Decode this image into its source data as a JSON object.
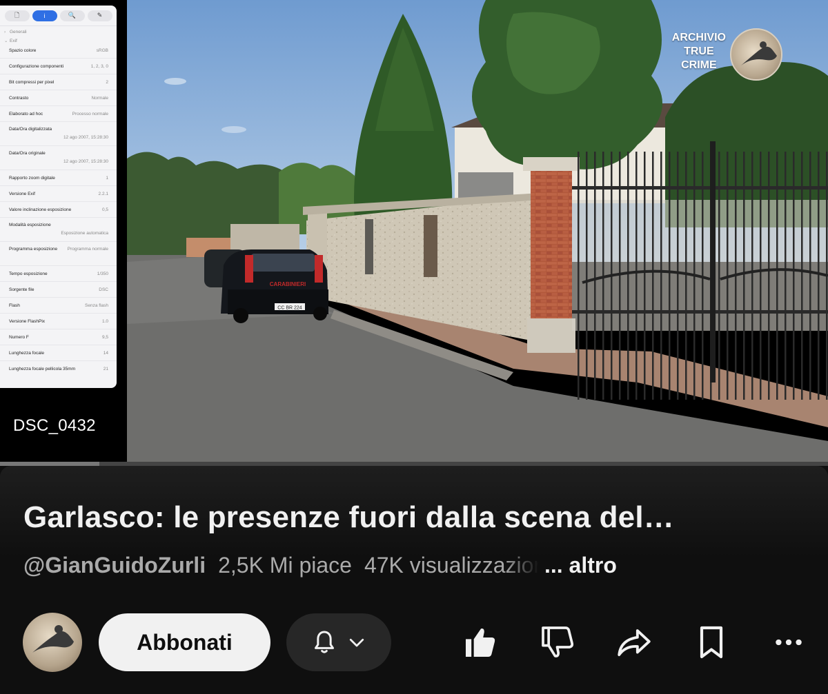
{
  "exif": {
    "toolbar_tabs": [
      {
        "icon": "document-icon",
        "glyph": "🗋"
      },
      {
        "icon": "info-icon",
        "glyph": "i"
      },
      {
        "icon": "search-icon",
        "glyph": "🔍"
      },
      {
        "icon": "edit-icon",
        "glyph": "✎"
      }
    ],
    "groups": [
      "Generali",
      "Exif"
    ],
    "rows": [
      {
        "key": "Spazio colore",
        "value": "sRGB"
      },
      {
        "key": "Configurazione componenti",
        "value": "1, 2, 3, 0"
      },
      {
        "key": "Bit compressi per pixel",
        "value": "2"
      },
      {
        "key": "Contrasto",
        "value": "Normale"
      },
      {
        "key": "Elaborato ad hoc",
        "value": "Processo normale"
      },
      {
        "key": "Data/Ora digitalizzata",
        "value": "12 ago 2007, 15:28:30"
      },
      {
        "key": "Data/Ora originale",
        "value": "12 ago 2007, 15:28:30"
      },
      {
        "key": "Rapporto zoom digitale",
        "value": "1"
      },
      {
        "key": "Versione Exif",
        "value": "2.2.1"
      },
      {
        "key": "Valore inclinazione esposizione",
        "value": "0,5"
      },
      {
        "key": "Modalità esposizione",
        "value": "Esposizione automatica"
      },
      {
        "key": "Programma esposizione",
        "value": "Programma normale"
      },
      {
        "key": "Tempo esposizione",
        "value": "1/350"
      },
      {
        "key": "Sorgente file",
        "value": "DSC"
      },
      {
        "key": "Flash",
        "value": "Senza flash"
      },
      {
        "key": "Versione FlashPix",
        "value": "1.0"
      },
      {
        "key": "Numero F",
        "value": "9,5"
      },
      {
        "key": "Lunghezza focale",
        "value": "14"
      },
      {
        "key": "Lunghezza focale pellicola 35mm",
        "value": "21"
      }
    ]
  },
  "video": {
    "file_label": "DSC_0432",
    "watermark_lines": [
      "ARCHIVIO",
      "TRUE",
      "CRIME"
    ],
    "car_text": "CARABINIERI",
    "plate_text": "CC BR 224",
    "progress_fraction": 0.12
  },
  "info": {
    "title": "Garlasco: le presenze fuori dalla scena del…",
    "channel": "@GianGuidoZurli",
    "likes": "2,5K Mi piace",
    "views": "47K visualizzazioni",
    "more": "... altro",
    "subscribe_label": "Abbonati"
  },
  "colors": {
    "background": "#0f0f0f",
    "accent": "#2f6fe4",
    "button_light": "#f1f1f1",
    "button_dark": "#272727"
  }
}
